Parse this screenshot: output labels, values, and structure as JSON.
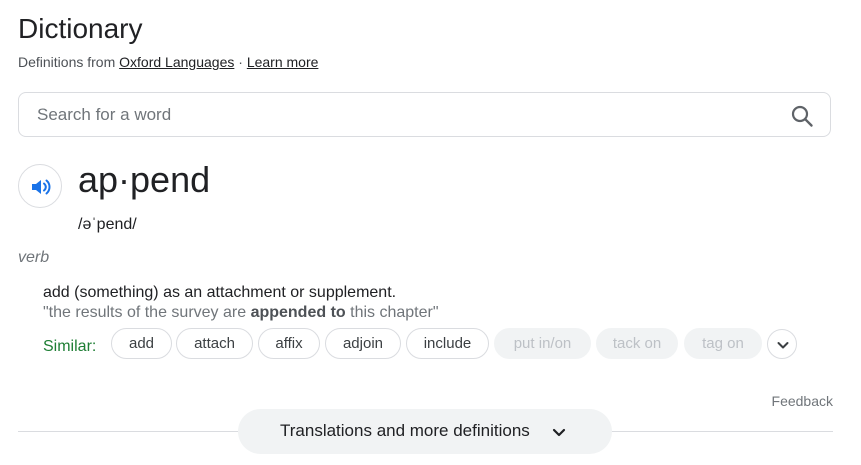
{
  "header": {
    "title": "Dictionary",
    "source_prefix": "Definitions from",
    "source_link": "Oxford Languages",
    "separator": "·",
    "learn_more": "Learn more"
  },
  "search": {
    "placeholder": "Search for a word",
    "icon": "search-icon"
  },
  "entry": {
    "audio_icon": "speaker-icon",
    "word": "ap·pend",
    "phonetic": "/əˈpend/",
    "part_of_speech": "verb",
    "definition": "add (something) as an attachment or supplement.",
    "example": {
      "before": "\"the results of the survey are ",
      "bold": "appended to",
      "after": " this chapter\""
    },
    "similar_label": "Similar:",
    "similar": [
      "add",
      "attach",
      "affix",
      "adjoin",
      "include"
    ],
    "similar_disabled": [
      "put in/on",
      "tack on",
      "tag on"
    ]
  },
  "footer": {
    "feedback": "Feedback",
    "more_button": "Translations and more definitions"
  },
  "colors": {
    "accent_blue": "#1a73e8",
    "similar_green": "#1e7e34"
  }
}
